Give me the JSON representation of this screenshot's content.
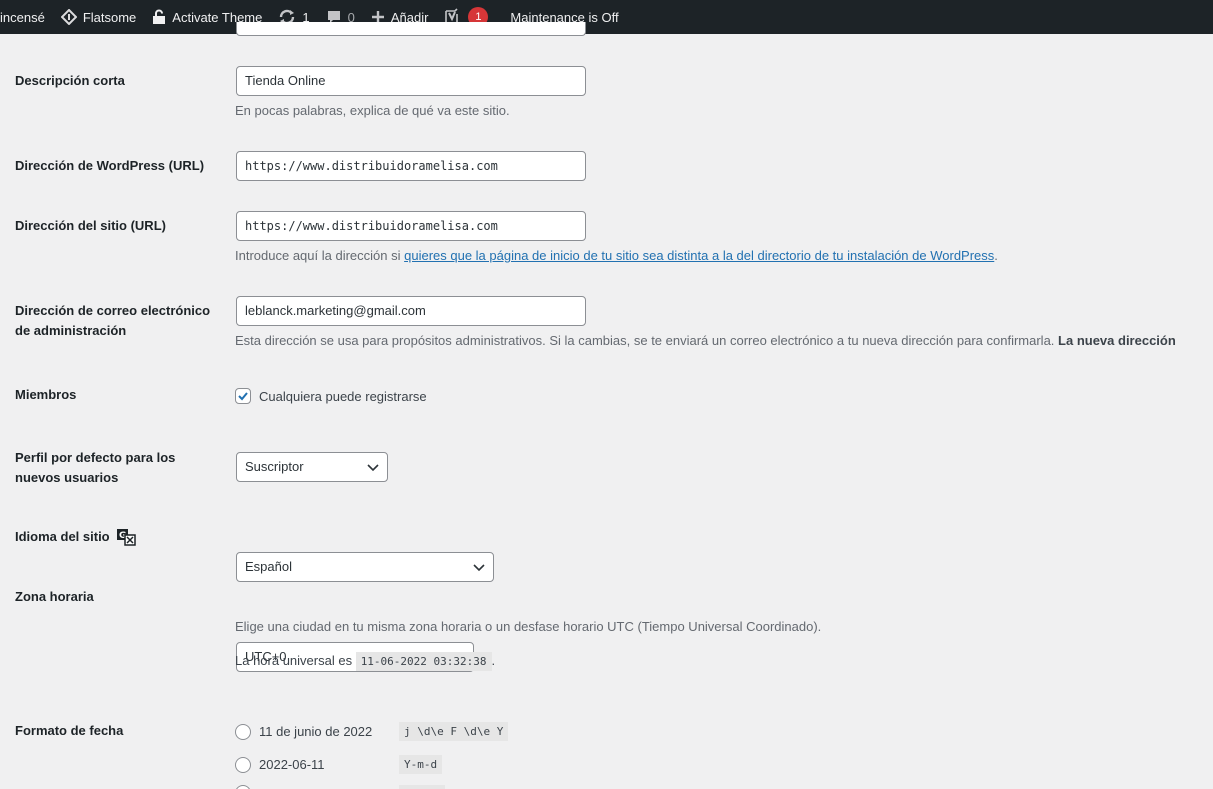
{
  "admin_bar": {
    "site_name": "incensé",
    "theme": "Flatsome",
    "activate_theme": "Activate Theme",
    "updates_count": "1",
    "comments_count": "0",
    "add_new": "Añadir",
    "seo_badge": "1",
    "maintenance": "Maintenance is Off"
  },
  "settings": {
    "tagline": {
      "label": "Descripción corta",
      "value": "Tienda Online",
      "description": "En pocas palabras, explica de qué va este sitio."
    },
    "wp_url": {
      "label": "Dirección de WordPress (URL)",
      "value": "https://www.distribuidoramelisa.com"
    },
    "site_url": {
      "label": "Dirección del sitio (URL)",
      "value": "https://www.distribuidoramelisa.com",
      "description_prefix": "Introduce aquí la dirección si ",
      "description_link": "quieres que la página de inicio de tu sitio sea distinta a la del directorio de tu instalación de WordPress",
      "description_suffix": "."
    },
    "admin_email": {
      "label_line1": "Dirección de correo electrónico",
      "label_line2": "de administración",
      "value": "leblanck.marketing@gmail.com",
      "description": "Esta dirección se usa para propósitos administrativos. Si la cambias, se te enviará un correo electrónico a tu nueva dirección para confirmarla. ",
      "description_bold": "La nueva dirección"
    },
    "membership": {
      "label": "Miembros",
      "checkbox_label": "Cualquiera puede registrarse",
      "checked": true
    },
    "default_role": {
      "label_line1": "Perfil por defecto para los",
      "label_line2": "nuevos usuarios",
      "value": "Suscriptor"
    },
    "site_language": {
      "label": "Idioma del sitio",
      "value": "Español"
    },
    "timezone": {
      "label": "Zona horaria",
      "value": "UTC+0",
      "description": "Elige una ciudad en tu misma zona horaria o un desfase horario UTC (Tiempo Universal Coordinado).",
      "utc_prefix": "La hora universal es ",
      "utc_time": "11-06-2022 03:32:38",
      "utc_suffix": "."
    },
    "date_format": {
      "label": "Formato de fecha",
      "options": [
        {
          "label": "11 de junio de 2022",
          "code": "j \\d\\e F \\d\\e Y"
        },
        {
          "label": "2022-06-11",
          "code": "Y-m-d"
        }
      ]
    }
  }
}
